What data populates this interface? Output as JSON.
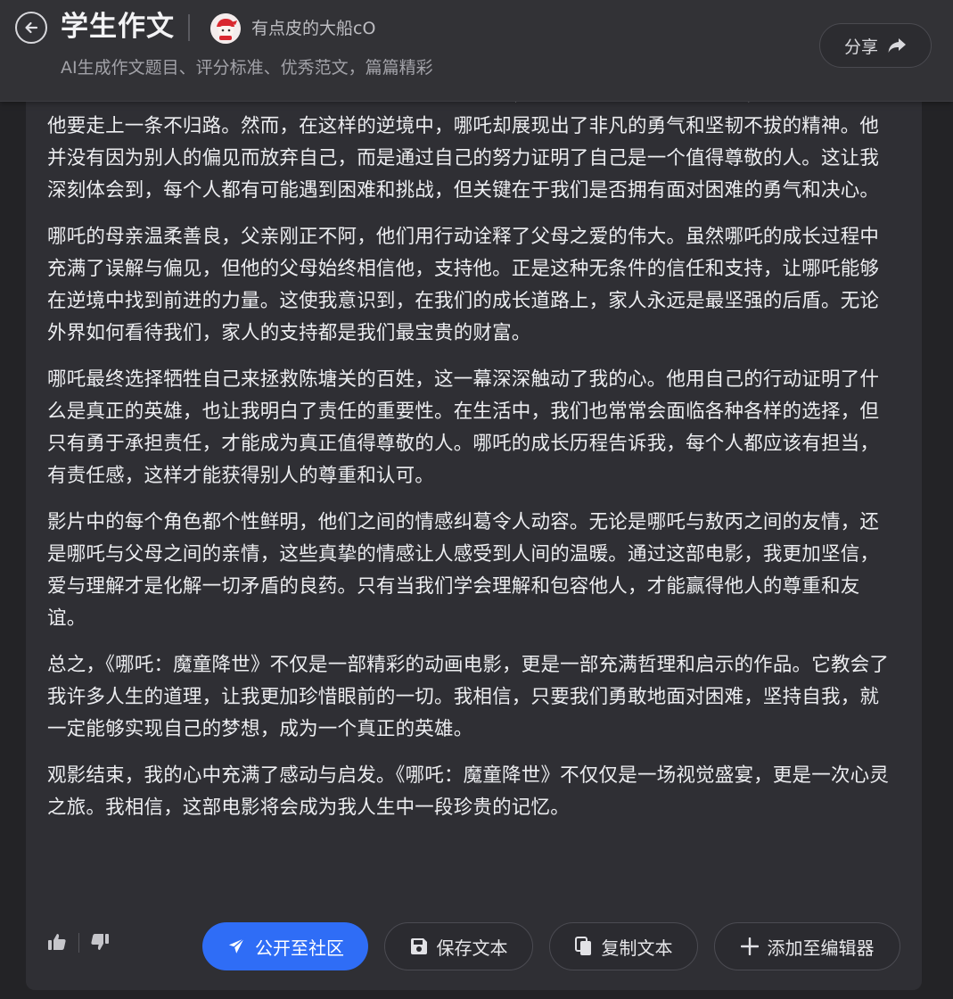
{
  "header": {
    "title": "学生作文",
    "username": "有点皮的大船cO",
    "subtitle": "AI生成作文题目、评分标准、优秀范文，篇篇精彩",
    "share_label": "分享"
  },
  "article": {
    "paragraphs": [
      "影片讲述了哪吒作为“魔童”降生人间的故事。从一开始，哪吒就被世人视为“妖孽”，命运似乎注定他要走上一条不归路。然而，在这样的逆境中，哪吒却展现出了非凡的勇气和坚韧不拔的精神。他并没有因为别人的偏见而放弃自己，而是通过自己的努力证明了自己是一个值得尊敬的人。这让我深刻体会到，每个人都有可能遇到困难和挑战，但关键在于我们是否拥有面对困难的勇气和决心。",
      "哪吒的母亲温柔善良，父亲刚正不阿，他们用行动诠释了父母之爱的伟大。虽然哪吒的成长过程中充满了误解与偏见，但他的父母始终相信他，支持他。正是这种无条件的信任和支持，让哪吒能够在逆境中找到前进的力量。这使我意识到，在我们的成长道路上，家人永远是最坚强的后盾。无论外界如何看待我们，家人的支持都是我们最宝贵的财富。",
      "哪吒最终选择牺牲自己来拯救陈塘关的百姓，这一幕深深触动了我的心。他用自己的行动证明了什么是真正的英雄，也让我明白了责任的重要性。在生活中，我们也常常会面临各种各样的选择，但只有勇于承担责任，才能成为真正值得尊敬的人。哪吒的成长历程告诉我，每个人都应该有担当，有责任感，这样才能获得别人的尊重和认可。",
      "影片中的每个角色都个性鲜明，他们之间的情感纠葛令人动容。无论是哪吒与敖丙之间的友情，还是哪吒与父母之间的亲情，这些真挚的情感让人感受到人间的温暖。通过这部电影，我更加坚信，爱与理解才是化解一切矛盾的良药。只有当我们学会理解和包容他人，才能赢得他人的尊重和友谊。",
      "总之，《哪吒：魔童降世》不仅是一部精彩的动画电影，更是一部充满哲理和启示的作品。它教会了我许多人生的道理，让我更加珍惜眼前的一切。我相信，只要我们勇敢地面对困难，坚持自我，就一定能够实现自己的梦想，成为一个真正的英雄。",
      "观影结束，我的心中充满了感动与启发。《哪吒：魔童降世》不仅仅是一场视觉盛宴，更是一次心灵之旅。我相信，这部电影将会成为我人生中一段珍贵的记忆。"
    ]
  },
  "toolbar": {
    "publish_label": "公开至社区",
    "save_label": "保存文本",
    "copy_label": "复制文本",
    "add_label": "添加至编辑器"
  },
  "colors": {
    "accent": "#2f6df6",
    "background": "#232326",
    "card": "#2f2f34",
    "header": "#323236"
  },
  "icons": {
    "back": "back-arrow-icon",
    "share": "share-arrow-icon",
    "like": "thumbs-up-icon",
    "dislike": "thumbs-down-icon",
    "publish": "paper-plane-icon",
    "save": "floppy-disk-icon",
    "copy": "copy-icon",
    "add": "plus-icon"
  }
}
